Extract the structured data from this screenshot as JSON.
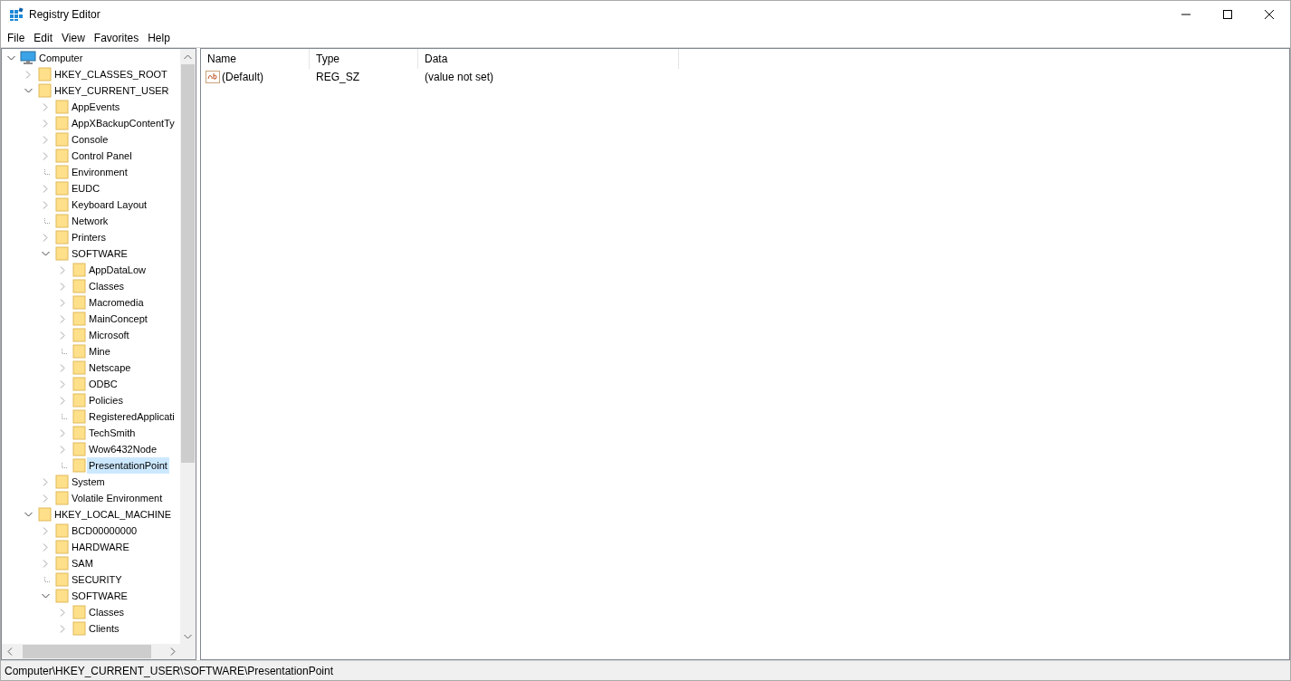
{
  "window": {
    "title": "Registry Editor"
  },
  "menu": [
    "File",
    "Edit",
    "View",
    "Favorites",
    "Help"
  ],
  "tree": [
    {
      "label": "Computer",
      "kind": "expanded",
      "selected": false,
      "children": [
        {
          "label": "HKEY_CLASSES_ROOT",
          "kind": "collapsed",
          "selected": false
        },
        {
          "label": "HKEY_CURRENT_USER",
          "kind": "expanded",
          "selected": false,
          "children": [
            {
              "label": "AppEvents",
              "kind": "collapsed",
              "selected": false
            },
            {
              "label": "AppXBackupContentTy",
              "kind": "collapsed",
              "selected": false
            },
            {
              "label": "Console",
              "kind": "collapsed",
              "selected": false
            },
            {
              "label": "Control Panel",
              "kind": "collapsed",
              "selected": false
            },
            {
              "label": "Environment",
              "kind": "leaf",
              "selected": false
            },
            {
              "label": "EUDC",
              "kind": "collapsed",
              "selected": false
            },
            {
              "label": "Keyboard Layout",
              "kind": "collapsed",
              "selected": false
            },
            {
              "label": "Network",
              "kind": "leaf",
              "selected": false
            },
            {
              "label": "Printers",
              "kind": "collapsed",
              "selected": false
            },
            {
              "label": "SOFTWARE",
              "kind": "expanded",
              "selected": false,
              "children": [
                {
                  "label": "AppDataLow",
                  "kind": "collapsed",
                  "selected": false
                },
                {
                  "label": "Classes",
                  "kind": "collapsed",
                  "selected": false
                },
                {
                  "label": "Macromedia",
                  "kind": "collapsed",
                  "selected": false
                },
                {
                  "label": "MainConcept",
                  "kind": "collapsed",
                  "selected": false
                },
                {
                  "label": "Microsoft",
                  "kind": "collapsed",
                  "selected": false
                },
                {
                  "label": "Mine",
                  "kind": "leaf",
                  "selected": false
                },
                {
                  "label": "Netscape",
                  "kind": "collapsed",
                  "selected": false
                },
                {
                  "label": "ODBC",
                  "kind": "collapsed",
                  "selected": false
                },
                {
                  "label": "Policies",
                  "kind": "collapsed",
                  "selected": false
                },
                {
                  "label": "RegisteredApplicati",
                  "kind": "leaf",
                  "selected": false
                },
                {
                  "label": "TechSmith",
                  "kind": "collapsed",
                  "selected": false
                },
                {
                  "label": "Wow6432Node",
                  "kind": "collapsed",
                  "selected": false
                },
                {
                  "label": "PresentationPoint",
                  "kind": "leaf",
                  "selected": true
                }
              ]
            },
            {
              "label": "System",
              "kind": "collapsed",
              "selected": false
            },
            {
              "label": "Volatile Environment",
              "kind": "collapsed",
              "selected": false
            }
          ]
        },
        {
          "label": "HKEY_LOCAL_MACHINE",
          "kind": "expanded",
          "selected": false,
          "children": [
            {
              "label": "BCD00000000",
              "kind": "collapsed",
              "selected": false
            },
            {
              "label": "HARDWARE",
              "kind": "collapsed",
              "selected": false
            },
            {
              "label": "SAM",
              "kind": "collapsed",
              "selected": false
            },
            {
              "label": "SECURITY",
              "kind": "leaf",
              "selected": false
            },
            {
              "label": "SOFTWARE",
              "kind": "expanded",
              "selected": false,
              "children": [
                {
                  "label": "Classes",
                  "kind": "collapsed",
                  "selected": false
                },
                {
                  "label": "Clients",
                  "kind": "collapsed",
                  "selected": false
                }
              ]
            }
          ]
        }
      ]
    }
  ],
  "values": {
    "columns": [
      "Name",
      "Type",
      "Data"
    ],
    "rows": [
      {
        "name": "(Default)",
        "type": "REG_SZ",
        "data": "(value not set)"
      }
    ]
  },
  "status_bar": "Computer\\HKEY_CURRENT_USER\\SOFTWARE\\PresentationPoint"
}
